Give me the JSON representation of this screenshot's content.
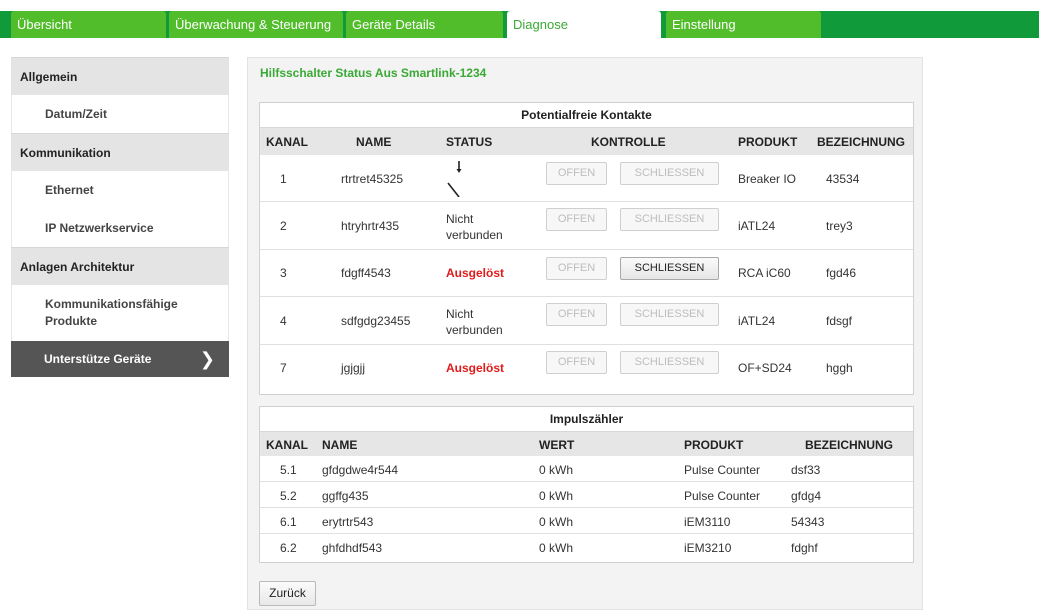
{
  "tabs": [
    {
      "label": "Übersicht"
    },
    {
      "label": "Überwachung & Steuerung"
    },
    {
      "label": "Geräte Details"
    },
    {
      "label": "Diagnose"
    },
    {
      "label": "Einstellung"
    }
  ],
  "sidebar": {
    "sections": [
      {
        "label": "Allgemein",
        "items": [
          {
            "label": "Datum/Zeit"
          }
        ]
      },
      {
        "label": "Kommunikation",
        "items": [
          {
            "label": "Ethernet"
          },
          {
            "label": "IP Netzwerkservice"
          }
        ]
      },
      {
        "label": "Anlagen Architektur",
        "items": [
          {
            "label": "Kommunikationsfähige Produkte"
          },
          {
            "label": "Unterstütze Geräte",
            "active": true
          }
        ]
      }
    ]
  },
  "main": {
    "title": "Hilfsschalter Status Aus Smartlink-1234",
    "contacts": {
      "title": "Potentialfreie Kontakte",
      "headers": {
        "kanal": "KANAL",
        "name": "NAME",
        "status": "STATUS",
        "kontrolle": "KONTROLLE",
        "produkt": "PRODUKT",
        "bezeichnung": "BEZEICHNUNG"
      },
      "open_label": "OFFEN",
      "close_label": "SCHLIESSEN",
      "rows": [
        {
          "kanal": "1",
          "name": "rtrtret45325",
          "status": "",
          "status_kind": "switch-open",
          "close_enabled": false,
          "produkt": "Breaker IO",
          "bezeichnung": "43534"
        },
        {
          "kanal": "2",
          "name": "htryhrtr435",
          "status": "Nicht verbunden",
          "status_kind": "text",
          "close_enabled": false,
          "produkt": "iATL24",
          "bezeichnung": "trey3"
        },
        {
          "kanal": "3",
          "name": "fdgff4543",
          "status": "Ausgelöst",
          "status_kind": "alert",
          "close_enabled": true,
          "produkt": "RCA iC60",
          "bezeichnung": "fgd46"
        },
        {
          "kanal": "4",
          "name": "sdfgdg23455",
          "status": "Nicht verbunden",
          "status_kind": "text",
          "close_enabled": false,
          "produkt": "iATL24",
          "bezeichnung": "fdsgf"
        },
        {
          "kanal": "7",
          "name": "jgjgjj",
          "status": "Ausgelöst",
          "status_kind": "alert",
          "close_enabled": false,
          "produkt": "OF+SD24",
          "bezeichnung": "hggh"
        }
      ]
    },
    "pulse": {
      "title": "Impulszähler",
      "headers": {
        "kanal": "KANAL",
        "name": "NAME",
        "wert": "WERT",
        "produkt": "PRODUKT",
        "bezeichnung": "BEZEICHNUNG"
      },
      "rows": [
        {
          "kanal": "5.1",
          "name": "gfdgdwe4r544",
          "wert": "0 kWh",
          "produkt": "Pulse Counter",
          "bezeichnung": "dsf33"
        },
        {
          "kanal": "5.2",
          "name": "ggffg435",
          "wert": "0 kWh",
          "produkt": "Pulse Counter",
          "bezeichnung": "gfdg4"
        },
        {
          "kanal": "6.1",
          "name": "erytrtr543",
          "wert": "0 kWh",
          "produkt": "iEM3110",
          "bezeichnung": "54343"
        },
        {
          "kanal": "6.2",
          "name": "ghfdhdf543",
          "wert": "0 kWh",
          "produkt": "iEM3210",
          "bezeichnung": "fdghf"
        }
      ]
    },
    "back_label": "Zurück"
  },
  "colors": {
    "brand_green": "#119a3a",
    "tab_green": "#52bd2b",
    "title_green": "#3aa935",
    "alert_red": "#e01b1b",
    "sidebar_active": "#555555"
  }
}
